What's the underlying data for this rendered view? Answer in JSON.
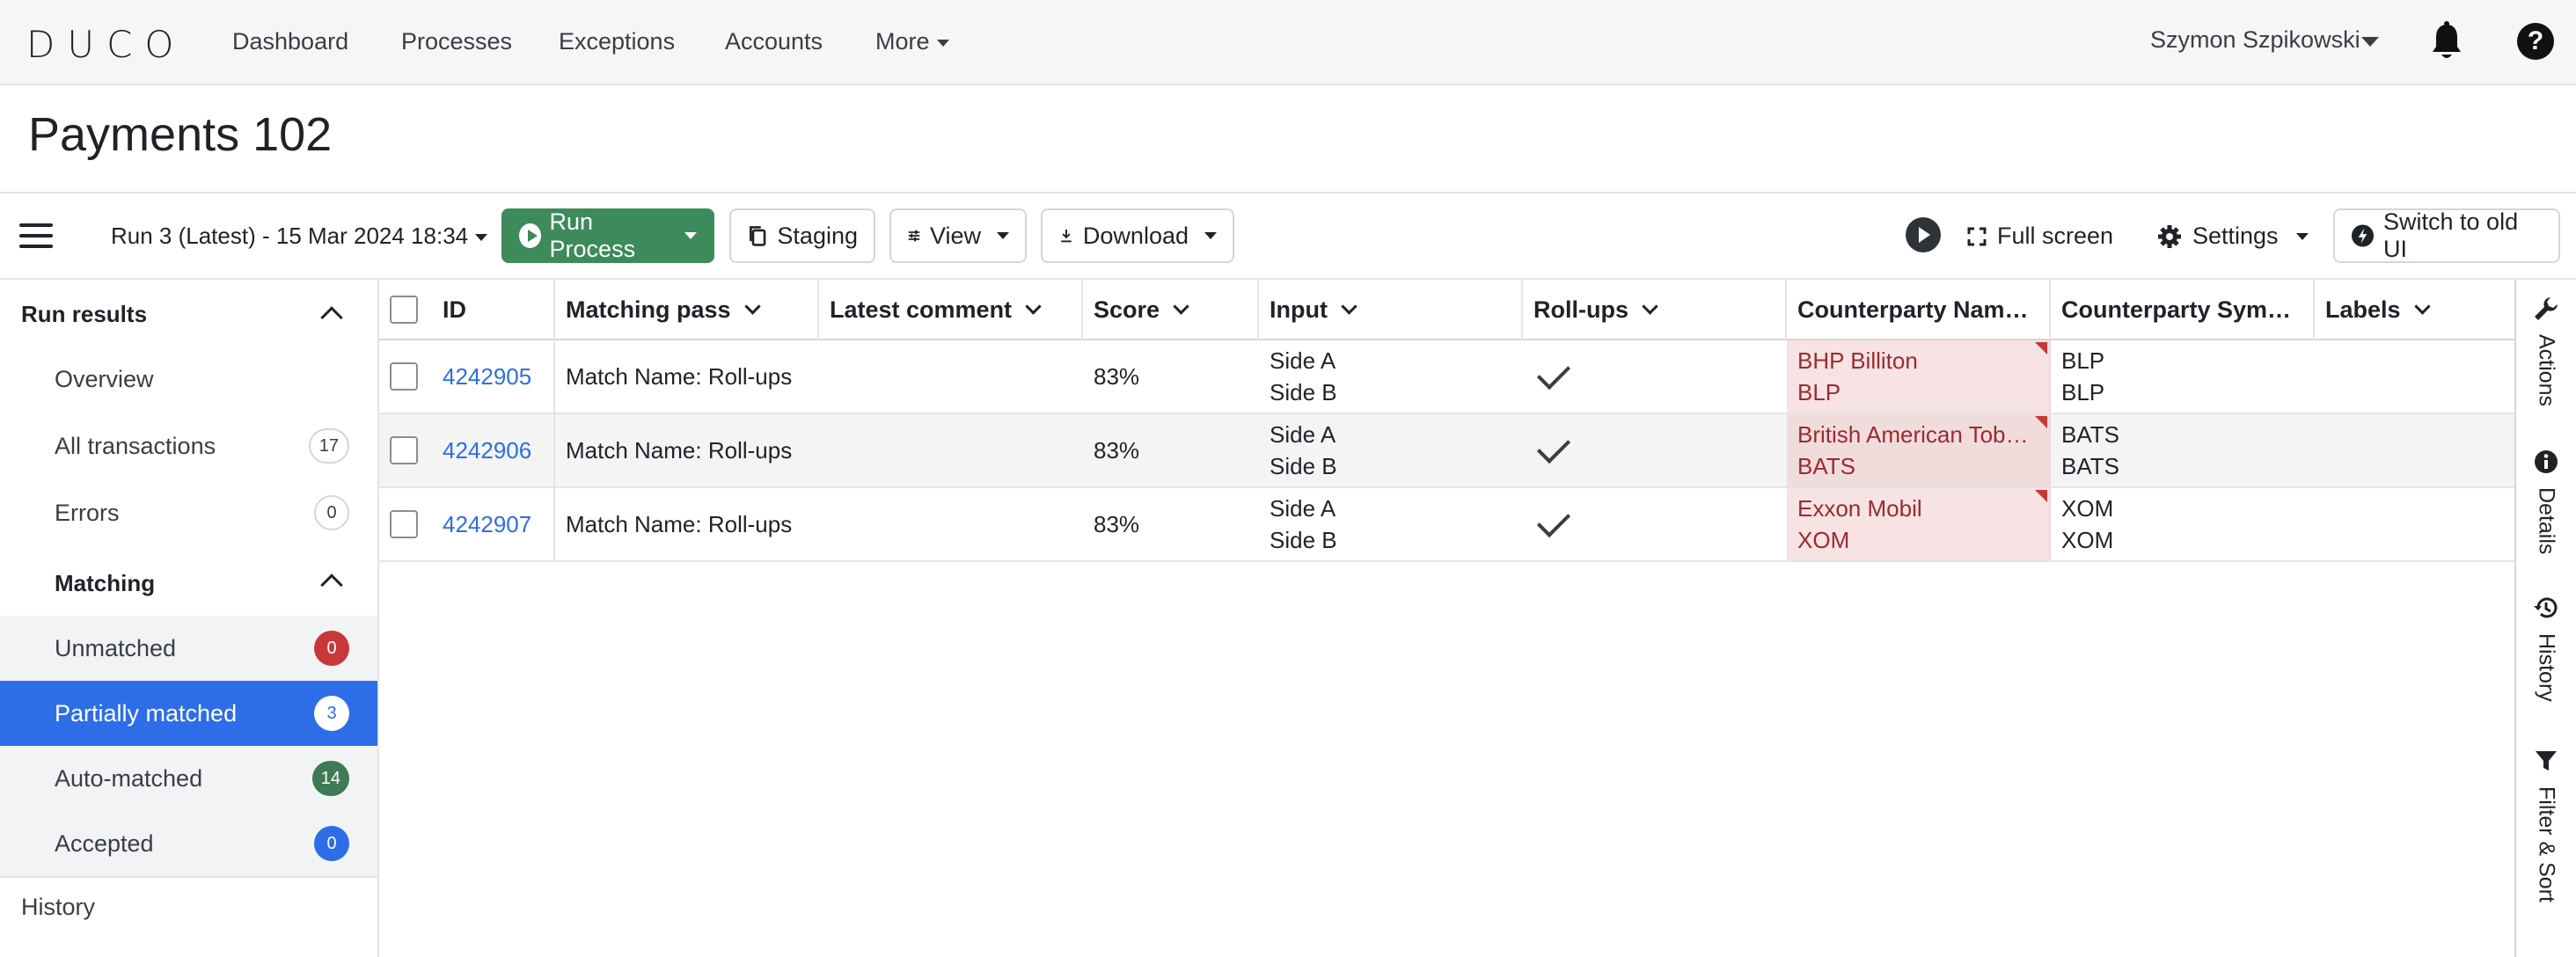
{
  "nav": {
    "logo": "DUCO",
    "items": [
      "Dashboard",
      "Processes",
      "Exceptions",
      "Accounts",
      "More"
    ],
    "user": "Szymon Szpikowski"
  },
  "page": {
    "title": "Payments 102"
  },
  "toolbar": {
    "run_select": "Run 3 (Latest) - 15 Mar 2024 18:34",
    "run_process": "Run Process",
    "staging": "Staging",
    "view": "View",
    "download": "Download",
    "full_screen": "Full screen",
    "settings": "Settings",
    "switch_ui": "Switch to old UI"
  },
  "sidebar": {
    "run_results": "Run results",
    "overview": "Overview",
    "all_transactions": {
      "label": "All transactions",
      "count": "17"
    },
    "errors": {
      "label": "Errors",
      "count": "0"
    },
    "matching": "Matching",
    "unmatched": {
      "label": "Unmatched",
      "count": "0"
    },
    "partially_matched": {
      "label": "Partially matched",
      "count": "3"
    },
    "auto_matched": {
      "label": "Auto-matched",
      "count": "14"
    },
    "accepted": {
      "label": "Accepted",
      "count": "0"
    },
    "history": "History"
  },
  "grid": {
    "columns": [
      "ID",
      "Matching pass",
      "Latest comment",
      "Score",
      "Input",
      "Roll-ups",
      "Counterparty Nam…",
      "Counterparty Sym…",
      "Labels"
    ],
    "rows": [
      {
        "id": "4242905",
        "pass": "Match Name: Roll-ups",
        "comment": "",
        "score": "83%",
        "input_a": "Side A",
        "input_b": "Side B",
        "name_a": "BHP Billiton",
        "name_b": "BLP",
        "sym_a": "BLP",
        "sym_b": "BLP",
        "labels": ""
      },
      {
        "id": "4242906",
        "pass": "Match Name: Roll-ups",
        "comment": "",
        "score": "83%",
        "input_a": "Side A",
        "input_b": "Side B",
        "name_a": "British American Tob…",
        "name_b": "BATS",
        "sym_a": "BATS",
        "sym_b": "BATS",
        "labels": ""
      },
      {
        "id": "4242907",
        "pass": "Match Name: Roll-ups",
        "comment": "",
        "score": "83%",
        "input_a": "Side A",
        "input_b": "Side B",
        "name_a": "Exxon Mobil",
        "name_b": "XOM",
        "sym_a": "XOM",
        "sym_b": "XOM",
        "labels": ""
      }
    ]
  },
  "rail": {
    "actions": "Actions",
    "details": "Details",
    "history": "History",
    "filter_sort": "Filter & Sort"
  },
  "colors": {
    "primary_blue": "#2d6ee8",
    "run_green": "#3d8a5b",
    "mismatch_bg": "#f7e3e3",
    "mismatch_text": "#9a2b2f",
    "badge_red": "#c9373b"
  }
}
